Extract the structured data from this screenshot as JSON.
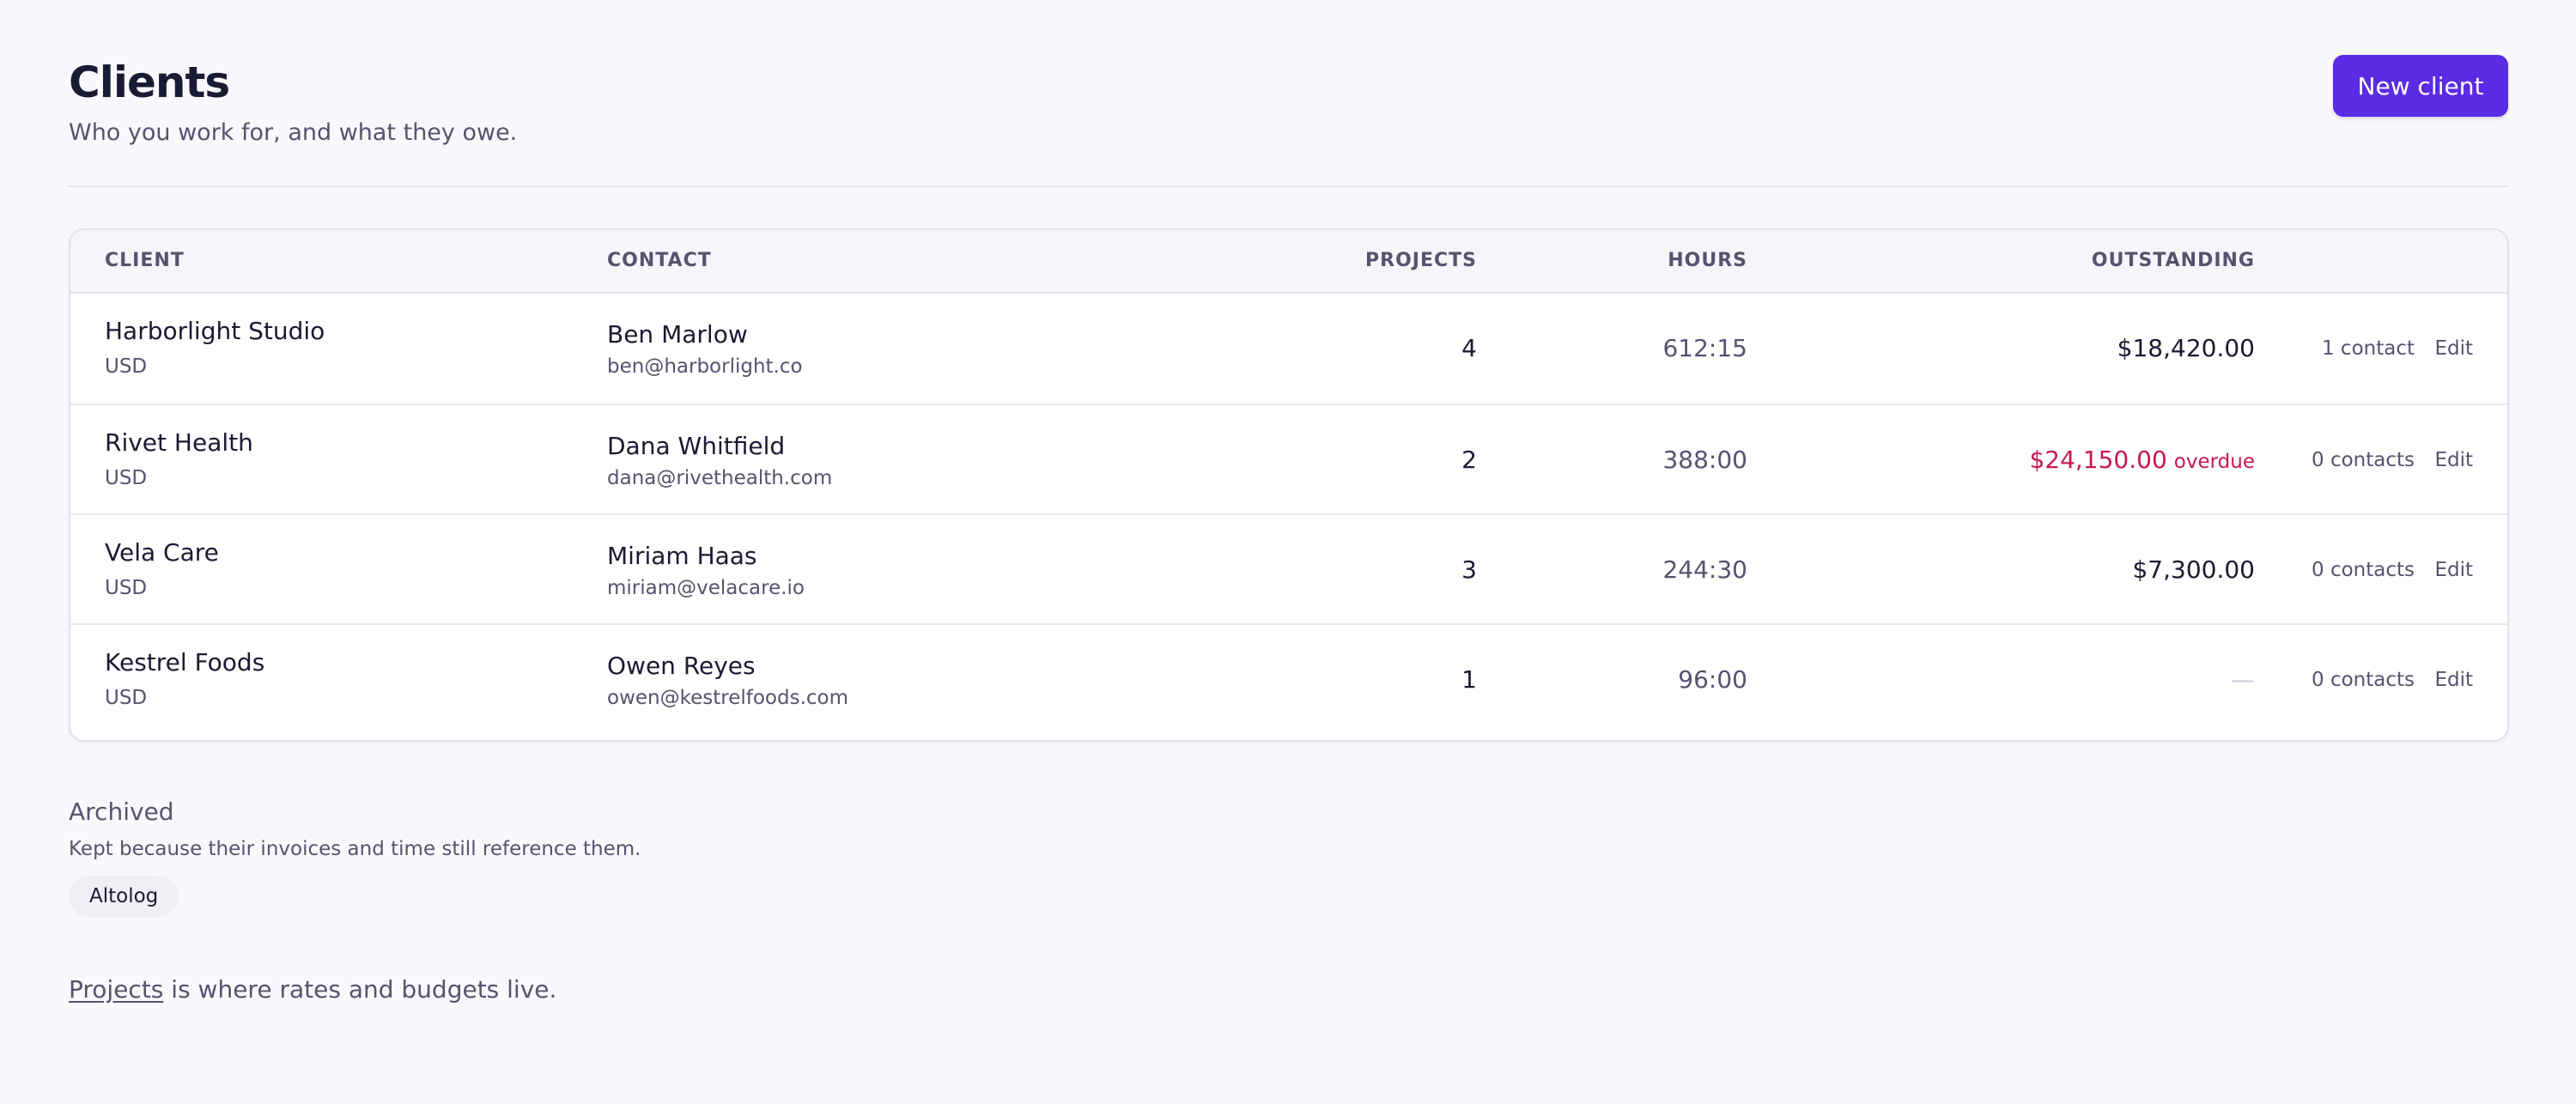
{
  "header": {
    "title": "Clients",
    "subtitle": "Who you work for, and what they owe.",
    "new_button_label": "New client"
  },
  "table": {
    "columns": [
      "CLIENT",
      "CONTACT",
      "PROJECTS",
      "HOURS",
      "OUTSTANDING"
    ],
    "rows": [
      {
        "name": "Harborlight Studio",
        "currency": "USD",
        "contact_name": "Ben Marlow",
        "contact_email": "ben@harborlight.co",
        "projects": "4",
        "hours": "612:15",
        "outstanding": "$18,420.00",
        "outstanding_flag": "",
        "contacts": "1 contact",
        "edit_label": "Edit"
      },
      {
        "name": "Rivet Health",
        "currency": "USD",
        "contact_name": "Dana Whitfield",
        "contact_email": "dana@rivethealth.com",
        "projects": "2",
        "hours": "388:00",
        "outstanding": "$24,150.00",
        "outstanding_flag": "overdue",
        "contacts": "0 contacts",
        "edit_label": "Edit"
      },
      {
        "name": "Vela Care",
        "currency": "USD",
        "contact_name": "Miriam Haas",
        "contact_email": "miriam@velacare.io",
        "projects": "3",
        "hours": "244:30",
        "outstanding": "$7,300.00",
        "outstanding_flag": "",
        "contacts": "0 contacts",
        "edit_label": "Edit"
      },
      {
        "name": "Kestrel Foods",
        "currency": "USD",
        "contact_name": "Owen Reyes",
        "contact_email": "owen@kestrelfoods.com",
        "projects": "1",
        "hours": "96:00",
        "outstanding": "—",
        "outstanding_flag": "",
        "contacts": "0 contacts",
        "edit_label": "Edit"
      }
    ]
  },
  "archived": {
    "title": "Archived",
    "description": "Kept because their invoices and time still reference them.",
    "clients": [
      "Altolog"
    ]
  },
  "footer": {
    "link_text": "Projects",
    "text": " is where rates and budgets live."
  },
  "colors": {
    "accent": "#5b2be6",
    "overdue": "#c81852"
  }
}
